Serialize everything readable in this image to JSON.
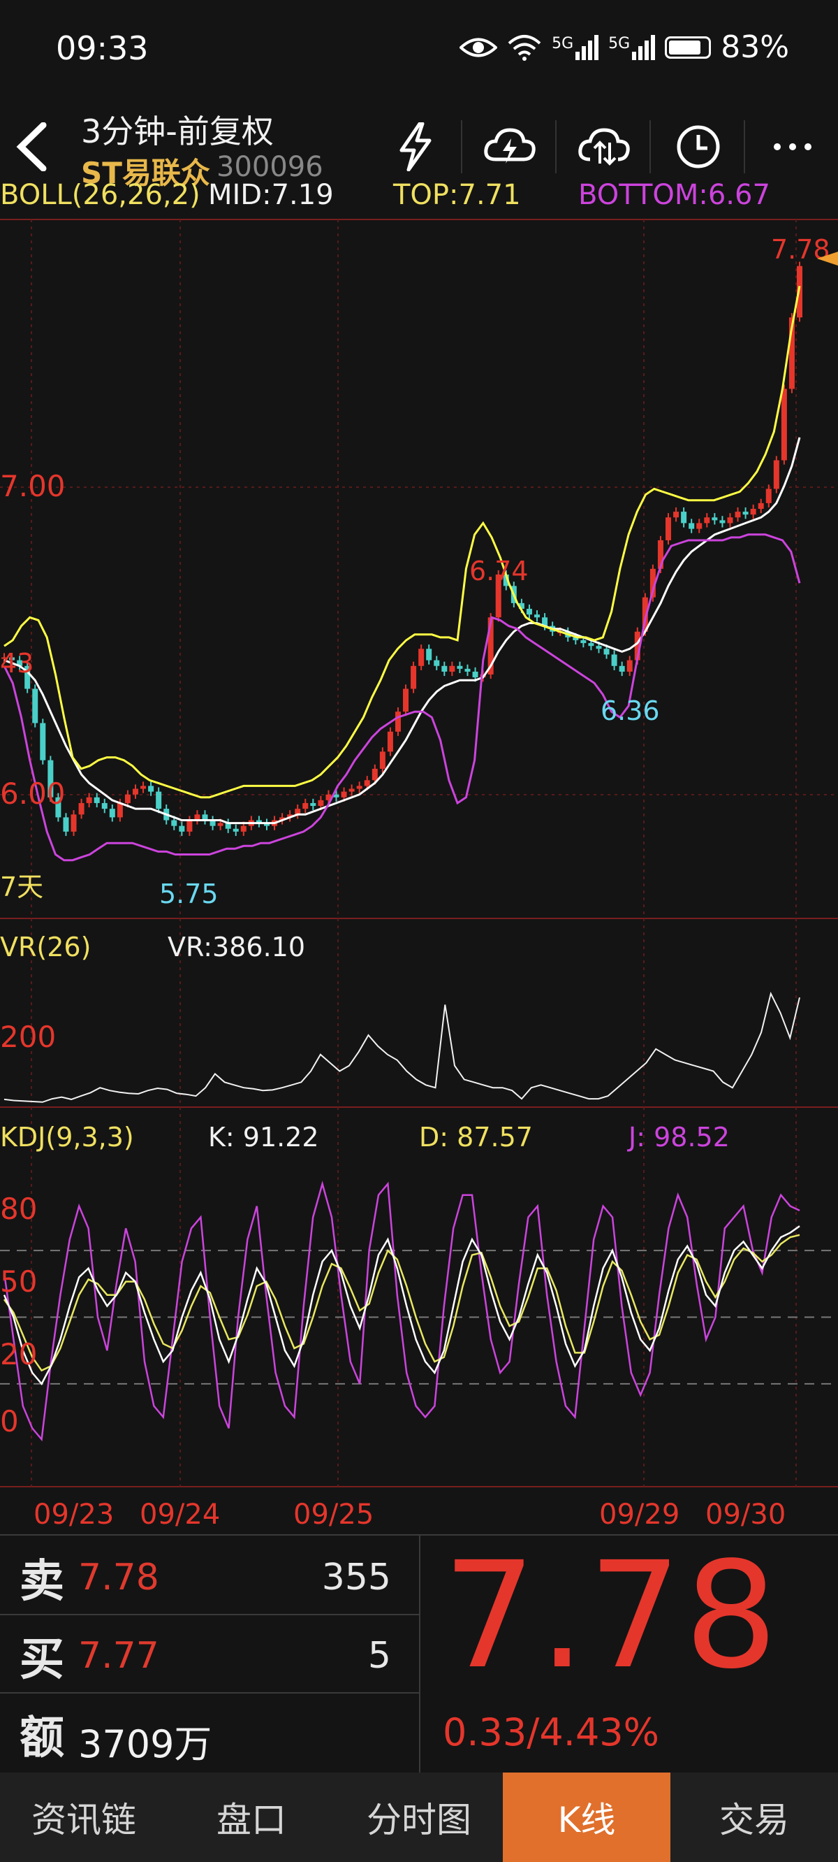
{
  "status_bar": {
    "time": "09:33",
    "network_1": "5G",
    "network_2": "5G",
    "battery_pct": "83%",
    "battery_level": 0.83
  },
  "header": {
    "back_icon": "chevron-left-icon",
    "title": "3分钟-前复权",
    "stock_name": "ST易联众",
    "stock_code": "300096",
    "actions": [
      "lightning-icon",
      "cloud-lightning-icon",
      "cloud-sync-icon",
      "clock-icon",
      "more-icon"
    ]
  },
  "indicators": {
    "boll": {
      "name": "BOLL(26,26,2)",
      "mid": "MID:7.19",
      "top": "TOP:7.71",
      "bottom": "BOTTOM:6.67"
    },
    "vr": {
      "name": "VR(26)",
      "value": "VR:386.10"
    },
    "kdj": {
      "name": "KDJ(9,3,3)",
      "k": "K: 91.22",
      "d": "D: 87.57",
      "j": "J: 98.52"
    }
  },
  "chart_data": {
    "type": "line",
    "main": {
      "price_ticks": [
        "7.00",
        "6.00"
      ],
      "annotations": [
        "7.78",
        "6.74",
        "6.36",
        "5.75",
        "43",
        "7天"
      ],
      "ylim": [
        5.55,
        7.85
      ],
      "close": [
        6.41,
        6.4,
        6.38,
        6.3,
        6.18,
        6.05,
        5.92,
        5.85,
        5.8,
        5.86,
        5.9,
        5.92,
        5.9,
        5.88,
        5.85,
        5.9,
        5.93,
        5.95,
        5.96,
        5.94,
        5.88,
        5.84,
        5.82,
        5.8,
        5.84,
        5.86,
        5.84,
        5.82,
        5.83,
        5.81,
        5.8,
        5.82,
        5.84,
        5.83,
        5.82,
        5.84,
        5.85,
        5.86,
        5.88,
        5.9,
        5.89,
        5.91,
        5.93,
        5.92,
        5.94,
        5.95,
        5.96,
        5.98,
        6.02,
        6.08,
        6.15,
        6.22,
        6.3,
        6.38,
        6.44,
        6.4,
        6.38,
        6.36,
        6.38,
        6.37,
        6.36,
        6.34,
        6.35,
        6.55,
        6.7,
        6.66,
        6.6,
        6.58,
        6.56,
        6.55,
        6.52,
        6.5,
        6.5,
        6.48,
        6.47,
        6.46,
        6.45,
        6.44,
        6.42,
        6.38,
        6.36,
        6.4,
        6.5,
        6.62,
        6.72,
        6.82,
        6.9,
        6.92,
        6.88,
        6.86,
        6.88,
        6.9,
        6.89,
        6.88,
        6.9,
        6.92,
        6.91,
        6.93,
        6.95,
        7.0,
        7.1,
        7.35,
        7.6,
        7.78
      ],
      "series": [
        {
          "name": "MID:7.19",
          "color": "#ffffff",
          "values": [
            6.4,
            6.39,
            6.38,
            6.36,
            6.33,
            6.28,
            6.22,
            6.16,
            6.1,
            6.05,
            6.0,
            5.97,
            5.95,
            5.93,
            5.91,
            5.9,
            5.89,
            5.88,
            5.88,
            5.88,
            5.87,
            5.86,
            5.85,
            5.84,
            5.84,
            5.84,
            5.84,
            5.84,
            5.84,
            5.83,
            5.83,
            5.83,
            5.83,
            5.83,
            5.83,
            5.83,
            5.84,
            5.85,
            5.86,
            5.86,
            5.87,
            5.88,
            5.89,
            5.9,
            5.91,
            5.92,
            5.93,
            5.95,
            5.97,
            6.0,
            6.04,
            6.08,
            6.12,
            6.17,
            6.22,
            6.26,
            6.29,
            6.31,
            6.32,
            6.33,
            6.33,
            6.33,
            6.34,
            6.38,
            6.43,
            6.47,
            6.5,
            6.52,
            6.53,
            6.53,
            6.52,
            6.51,
            6.51,
            6.5,
            6.49,
            6.48,
            6.47,
            6.46,
            6.45,
            6.44,
            6.43,
            6.44,
            6.46,
            6.5,
            6.55,
            6.6,
            6.66,
            6.71,
            6.75,
            6.78,
            6.8,
            6.82,
            6.84,
            6.85,
            6.86,
            6.87,
            6.88,
            6.89,
            6.9,
            6.92,
            6.95,
            7.01,
            7.08,
            7.18
          ]
        },
        {
          "name": "TOP:7.71",
          "color": "#ffff44",
          "values": [
            6.45,
            6.47,
            6.52,
            6.55,
            6.54,
            6.48,
            6.35,
            6.2,
            6.06,
            6.02,
            6.03,
            6.05,
            6.06,
            6.06,
            6.05,
            6.03,
            6.0,
            5.98,
            5.97,
            5.96,
            5.95,
            5.94,
            5.93,
            5.92,
            5.92,
            5.93,
            5.94,
            5.95,
            5.96,
            5.96,
            5.96,
            5.96,
            5.96,
            5.96,
            5.96,
            5.97,
            5.98,
            6.0,
            6.03,
            6.06,
            6.1,
            6.15,
            6.2,
            6.27,
            6.33,
            6.4,
            6.44,
            6.47,
            6.49,
            6.49,
            6.49,
            6.48,
            6.48,
            6.47,
            6.72,
            6.84,
            6.88,
            6.83,
            6.76,
            6.67,
            6.6,
            6.55,
            6.53,
            6.52,
            6.51,
            6.5,
            6.49,
            6.48,
            6.48,
            6.47,
            6.48,
            6.57,
            6.72,
            6.84,
            6.92,
            6.98,
            7.0,
            6.99,
            6.98,
            6.97,
            6.96,
            6.96,
            6.96,
            6.96,
            6.97,
            6.98,
            6.99,
            7.02,
            7.06,
            7.12,
            7.2,
            7.35,
            7.55,
            7.71
          ]
        },
        {
          "name": "BOTTOM:6.67",
          "color": "#cc44dd",
          "values": [
            6.38,
            6.32,
            6.2,
            6.05,
            5.92,
            5.8,
            5.72,
            5.7,
            5.7,
            5.71,
            5.72,
            5.74,
            5.76,
            5.76,
            5.76,
            5.76,
            5.75,
            5.74,
            5.73,
            5.73,
            5.72,
            5.72,
            5.72,
            5.72,
            5.72,
            5.73,
            5.74,
            5.74,
            5.75,
            5.75,
            5.76,
            5.76,
            5.77,
            5.78,
            5.79,
            5.8,
            5.82,
            5.85,
            5.9,
            5.96,
            6.0,
            6.05,
            6.09,
            6.13,
            6.16,
            6.18,
            6.2,
            6.21,
            6.22,
            6.22,
            6.2,
            6.12,
            5.98,
            5.9,
            5.92,
            6.05,
            6.4,
            6.55,
            6.54,
            6.52,
            6.51,
            6.48,
            6.46,
            6.44,
            6.42,
            6.4,
            6.38,
            6.36,
            6.34,
            6.32,
            6.28,
            6.22,
            6.2,
            6.24,
            6.4,
            6.55,
            6.66,
            6.75,
            6.8,
            6.81,
            6.82,
            6.82,
            6.82,
            6.82,
            6.82,
            6.83,
            6.83,
            6.84,
            6.84,
            6.84,
            6.83,
            6.82,
            6.78,
            6.67
          ]
        }
      ]
    },
    "vr": {
      "tick": "200",
      "ylim": [
        0,
        500
      ],
      "values": [
        18,
        14,
        12,
        10,
        8,
        20,
        26,
        18,
        30,
        42,
        60,
        50,
        44,
        40,
        38,
        50,
        58,
        54,
        40,
        36,
        30,
        60,
        110,
        80,
        70,
        60,
        56,
        50,
        52,
        60,
        70,
        80,
        120,
        180,
        150,
        120,
        140,
        190,
        250,
        210,
        180,
        160,
        120,
        90,
        70,
        60,
        360,
        140,
        90,
        80,
        70,
        60,
        60,
        50,
        20,
        60,
        70,
        60,
        50,
        40,
        30,
        20,
        20,
        30,
        60,
        90,
        120,
        150,
        200,
        180,
        160,
        150,
        140,
        130,
        120,
        80,
        60,
        120,
        180,
        260,
        400,
        330,
        240,
        386
      ]
    },
    "kdj": {
      "ticks": [
        "80",
        "50",
        "20",
        "0"
      ],
      "ylim": [
        -20,
        120
      ],
      "K": [
        60,
        50,
        35,
        25,
        20,
        28,
        40,
        55,
        68,
        72,
        62,
        55,
        60,
        70,
        66,
        52,
        40,
        30,
        35,
        50,
        62,
        70,
        58,
        40,
        30,
        42,
        58,
        72,
        65,
        50,
        35,
        28,
        40,
        60,
        75,
        80,
        70,
        55,
        45,
        60,
        78,
        85,
        72,
        55,
        40,
        30,
        25,
        35,
        55,
        75,
        85,
        78,
        62,
        48,
        40,
        50,
        65,
        78,
        70,
        55,
        38,
        28,
        35,
        55,
        72,
        80,
        68,
        52,
        40,
        35,
        45,
        62,
        76,
        82,
        74,
        60,
        55,
        70,
        80,
        84,
        78,
        72,
        80,
        86,
        88,
        91
      ],
      "D": [
        58,
        52,
        42,
        32,
        26,
        28,
        36,
        48,
        60,
        67,
        65,
        60,
        60,
        66,
        66,
        58,
        47,
        38,
        36,
        44,
        55,
        64,
        61,
        50,
        40,
        41,
        51,
        64,
        66,
        58,
        46,
        36,
        38,
        50,
        64,
        74,
        72,
        63,
        53,
        56,
        70,
        80,
        76,
        64,
        50,
        38,
        30,
        32,
        46,
        64,
        78,
        79,
        68,
        55,
        46,
        48,
        59,
        72,
        72,
        62,
        46,
        34,
        34,
        48,
        64,
        75,
        71,
        60,
        48,
        40,
        42,
        55,
        70,
        78,
        76,
        66,
        59,
        66,
        76,
        81,
        79,
        75,
        78,
        83,
        86,
        87
      ],
      "J": [
        70,
        40,
        10,
        0,
        -5,
        30,
        60,
        85,
        100,
        90,
        50,
        35,
        65,
        90,
        75,
        30,
        10,
        5,
        40,
        75,
        90,
        95,
        50,
        10,
        0,
        50,
        85,
        100,
        60,
        25,
        10,
        5,
        55,
        95,
        110,
        95,
        60,
        30,
        20,
        80,
        105,
        110,
        60,
        25,
        10,
        5,
        10,
        55,
        90,
        105,
        105,
        70,
        40,
        25,
        30,
        65,
        95,
        100,
        60,
        30,
        10,
        5,
        45,
        85,
        100,
        95,
        55,
        25,
        15,
        25,
        60,
        90,
        105,
        95,
        65,
        40,
        50,
        90,
        95,
        100,
        80,
        70,
        95,
        105,
        100,
        98
      ]
    },
    "x_labels": [
      "09/23",
      "09/24",
      "09/25",
      "09/29",
      "09/30"
    ]
  },
  "order_panel": {
    "sell_label": "卖",
    "sell_price": "7.78",
    "sell_volume": "355",
    "buy_label": "买",
    "buy_price": "7.77",
    "buy_volume": "5",
    "amount_label": "额",
    "amount_value": "3709万",
    "last_price": "7.78",
    "change": "0.33/4.43%"
  },
  "bottom_nav": {
    "tabs": [
      "资讯链",
      "盘口",
      "分时图",
      "K线",
      "交易"
    ],
    "active": "K线"
  },
  "colors": {
    "up_red": "#e5362c",
    "boll_top": "#ffff44",
    "boll_mid": "#ffffff",
    "boll_bottom": "#cc44dd",
    "kdj_k": "#ffffff",
    "kdj_d": "#e8e860",
    "kdj_j": "#cc44dd",
    "stock_name_gold": "#e8b84a",
    "low_annotation_cyan": "#6ad8f0",
    "tab_active": "#e0702c"
  }
}
